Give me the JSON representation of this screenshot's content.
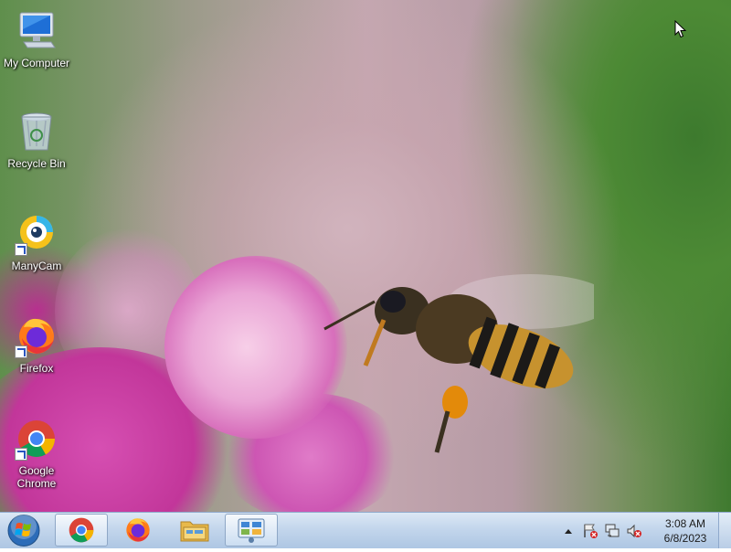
{
  "desktop": {
    "icons": [
      {
        "label": "My Computer",
        "icon": "computer-icon",
        "shortcut": false
      },
      {
        "label": "Recycle Bin",
        "icon": "recycle-bin-icon",
        "shortcut": false
      },
      {
        "label": "ManyCam",
        "icon": "manycam-icon",
        "shortcut": true
      },
      {
        "label": "Firefox",
        "icon": "firefox-icon",
        "shortcut": true
      },
      {
        "label": "Google Chrome",
        "icon": "chrome-icon",
        "shortcut": true
      }
    ]
  },
  "taskbar": {
    "start_icon": "windows-start-icon",
    "pinned": [
      {
        "icon": "chrome-icon",
        "active": true
      },
      {
        "icon": "firefox-icon",
        "active": false
      },
      {
        "icon": "file-explorer-icon",
        "active": false
      },
      {
        "icon": "control-panel-icon",
        "active": true
      }
    ],
    "tray": {
      "icons": [
        "show-hidden-icons-arrow",
        "action-center-flag-icon",
        "network-icon",
        "volume-muted-icon"
      ],
      "time": "3:08 AM",
      "date": "6/8/2023"
    }
  },
  "colors": {
    "taskbar": "#c3d6ec",
    "chrome_red": "#db4437",
    "chrome_yellow": "#f4b400",
    "chrome_green": "#0f9d58",
    "chrome_blue": "#4285f4"
  }
}
